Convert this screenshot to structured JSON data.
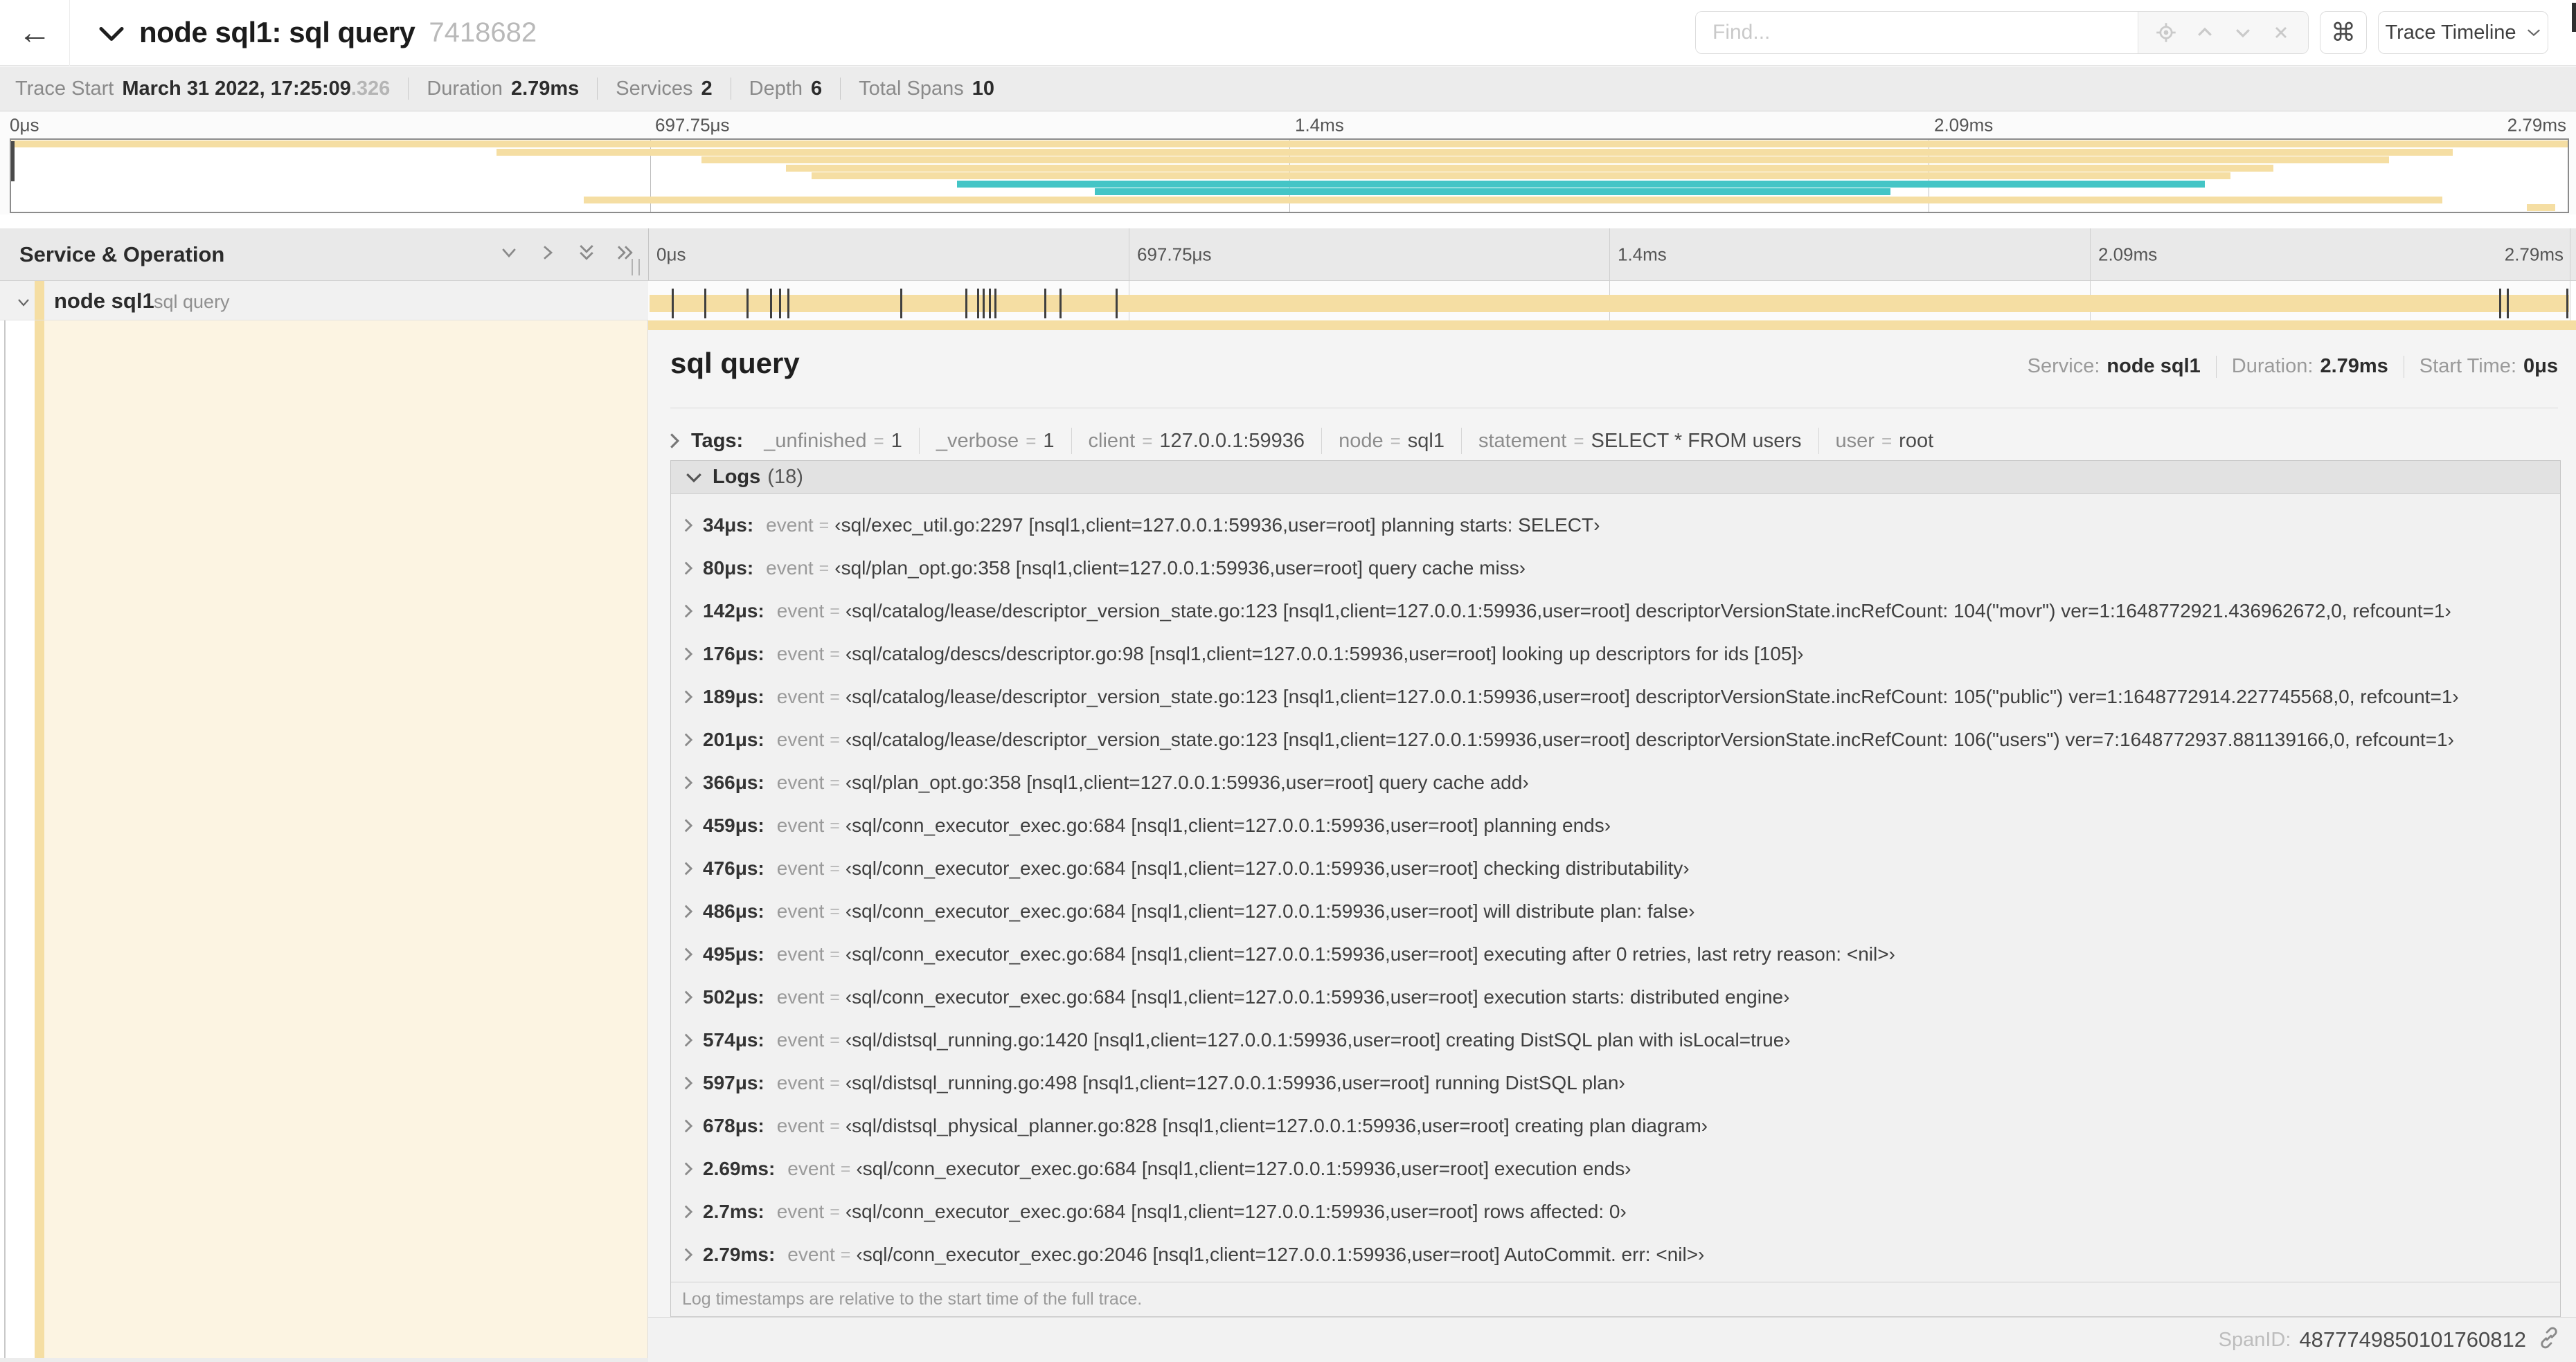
{
  "header": {
    "title": "node sql1: sql query",
    "trace_id": "7418682",
    "find": {
      "placeholder": "Find..."
    },
    "shortcut_button": "⌘",
    "view_dropdown": "Trace Timeline"
  },
  "meta": {
    "items": [
      {
        "label": "Trace Start",
        "value": "March 31 2022, 17:25:09",
        "suffix": ".326"
      },
      {
        "label": "Duration",
        "value": "2.79ms"
      },
      {
        "label": "Services",
        "value": "2"
      },
      {
        "label": "Depth",
        "value": "6"
      },
      {
        "label": "Total Spans",
        "value": "10"
      }
    ]
  },
  "timeline": {
    "ticks": [
      "0μs",
      "697.75μs",
      "1.4ms",
      "2.09ms",
      "2.79ms"
    ],
    "left_header": "Service & Operation",
    "row": {
      "service": "node sql1",
      "operation": "sql query"
    },
    "log_marker_fractions": [
      0.012,
      0.029,
      0.051,
      0.063,
      0.068,
      0.072,
      0.131,
      0.165,
      0.171,
      0.174,
      0.177,
      0.18,
      0.206,
      0.214,
      0.243,
      0.964,
      0.968,
      0.999
    ],
    "minimap_spans": [
      {
        "start": 0.0,
        "end": 1.0,
        "color": "tan"
      },
      {
        "start": 0.19,
        "end": 0.955,
        "color": "tan"
      },
      {
        "start": 0.27,
        "end": 0.93,
        "color": "tan"
      },
      {
        "start": 0.303,
        "end": 0.885,
        "color": "tan"
      },
      {
        "start": 0.313,
        "end": 0.868,
        "color": "tan"
      },
      {
        "start": 0.37,
        "end": 0.858,
        "color": "teal"
      },
      {
        "start": 0.424,
        "end": 0.735,
        "color": "teal"
      },
      {
        "start": 0.224,
        "end": 0.951,
        "color": "tan"
      },
      {
        "start": 0.984,
        "end": 0.995,
        "color": "tan"
      }
    ]
  },
  "detail": {
    "title": "sql query",
    "stats": [
      {
        "label": "Service:",
        "value": "node sql1"
      },
      {
        "label": "Duration:",
        "value": "2.79ms"
      },
      {
        "label": "Start Time:",
        "value": "0μs"
      }
    ],
    "tags": {
      "label": "Tags:",
      "items": [
        {
          "key": "_unfinished",
          "value": "1"
        },
        {
          "key": "_verbose",
          "value": "1"
        },
        {
          "key": "client",
          "value": "127.0.0.1:59936"
        },
        {
          "key": "node",
          "value": "sql1"
        },
        {
          "key": "statement",
          "value": "SELECT * FROM users"
        },
        {
          "key": "user",
          "value": "root"
        }
      ]
    },
    "logs": {
      "label": "Logs",
      "count": "(18)",
      "entries": [
        {
          "time": "34μs:",
          "key": "event",
          "value": "‹sql/exec_util.go:2297 [nsql1,client=127.0.0.1:59936,user=root] planning starts: SELECT›"
        },
        {
          "time": "80μs:",
          "key": "event",
          "value": "‹sql/plan_opt.go:358 [nsql1,client=127.0.0.1:59936,user=root] query cache miss›"
        },
        {
          "time": "142μs:",
          "key": "event",
          "value": "‹sql/catalog/lease/descriptor_version_state.go:123 [nsql1,client=127.0.0.1:59936,user=root] descriptorVersionState.incRefCount: 104(\"movr\") ver=1:1648772921.436962672,0, refcount=1›"
        },
        {
          "time": "176μs:",
          "key": "event",
          "value": "‹sql/catalog/descs/descriptor.go:98 [nsql1,client=127.0.0.1:59936,user=root] looking up descriptors for ids [105]›"
        },
        {
          "time": "189μs:",
          "key": "event",
          "value": "‹sql/catalog/lease/descriptor_version_state.go:123 [nsql1,client=127.0.0.1:59936,user=root] descriptorVersionState.incRefCount: 105(\"public\") ver=1:1648772914.227745568,0, refcount=1›"
        },
        {
          "time": "201μs:",
          "key": "event",
          "value": "‹sql/catalog/lease/descriptor_version_state.go:123 [nsql1,client=127.0.0.1:59936,user=root] descriptorVersionState.incRefCount: 106(\"users\") ver=7:1648772937.881139166,0, refcount=1›"
        },
        {
          "time": "366μs:",
          "key": "event",
          "value": "‹sql/plan_opt.go:358 [nsql1,client=127.0.0.1:59936,user=root] query cache add›"
        },
        {
          "time": "459μs:",
          "key": "event",
          "value": "‹sql/conn_executor_exec.go:684 [nsql1,client=127.0.0.1:59936,user=root] planning ends›"
        },
        {
          "time": "476μs:",
          "key": "event",
          "value": "‹sql/conn_executor_exec.go:684 [nsql1,client=127.0.0.1:59936,user=root] checking distributability›"
        },
        {
          "time": "486μs:",
          "key": "event",
          "value": "‹sql/conn_executor_exec.go:684 [nsql1,client=127.0.0.1:59936,user=root] will distribute plan: false›"
        },
        {
          "time": "495μs:",
          "key": "event",
          "value": "‹sql/conn_executor_exec.go:684 [nsql1,client=127.0.0.1:59936,user=root] executing after 0 retries, last retry reason: <nil>›"
        },
        {
          "time": "502μs:",
          "key": "event",
          "value": "‹sql/conn_executor_exec.go:684 [nsql1,client=127.0.0.1:59936,user=root] execution starts: distributed engine›"
        },
        {
          "time": "574μs:",
          "key": "event",
          "value": "‹sql/distsql_running.go:1420 [nsql1,client=127.0.0.1:59936,user=root] creating DistSQL plan with isLocal=true›"
        },
        {
          "time": "597μs:",
          "key": "event",
          "value": "‹sql/distsql_running.go:498 [nsql1,client=127.0.0.1:59936,user=root] running DistSQL plan›"
        },
        {
          "time": "678μs:",
          "key": "event",
          "value": "‹sql/distsql_physical_planner.go:828 [nsql1,client=127.0.0.1:59936,user=root] creating plan diagram›"
        },
        {
          "time": "2.69ms:",
          "key": "event",
          "value": "‹sql/conn_executor_exec.go:684 [nsql1,client=127.0.0.1:59936,user=root] execution ends›"
        },
        {
          "time": "2.7ms:",
          "key": "event",
          "value": "‹sql/conn_executor_exec.go:684 [nsql1,client=127.0.0.1:59936,user=root] rows affected: 0›"
        },
        {
          "time": "2.79ms:",
          "key": "event",
          "value": "‹sql/conn_executor_exec.go:2046 [nsql1,client=127.0.0.1:59936,user=root] AutoCommit. err: <nil>›"
        }
      ],
      "footnote": "Log timestamps are relative to the start time of the full trace."
    },
    "span_id_label": "SpanID:",
    "span_id_value": "4877749850101760812"
  },
  "colors": {
    "span_tan": "#F5DEA3",
    "span_teal": "#44C5C6",
    "row_cream": "#FCF4E2"
  }
}
